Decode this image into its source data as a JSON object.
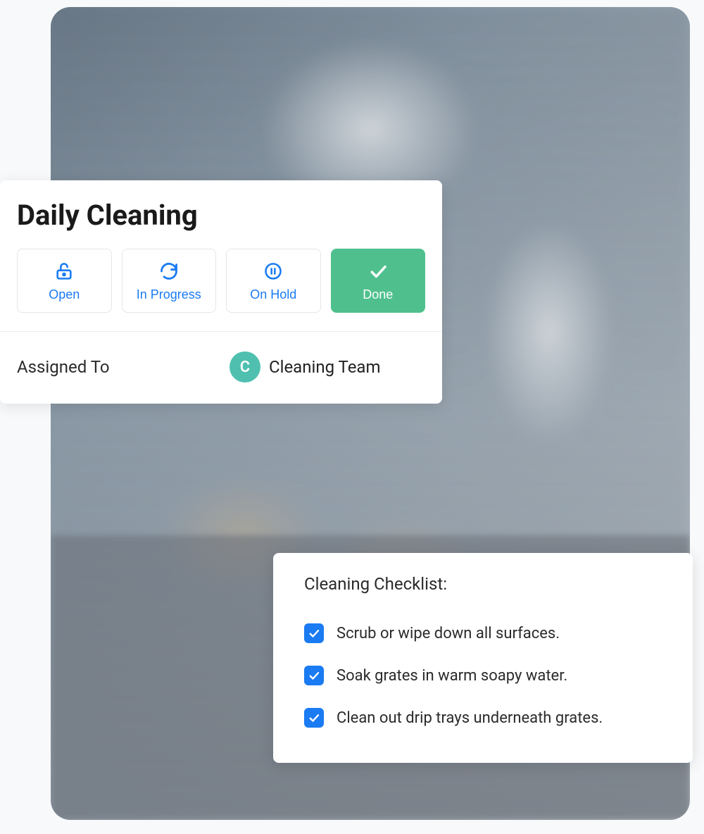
{
  "task": {
    "title": "Daily Cleaning",
    "statuses": [
      {
        "icon": "unlock",
        "label": "Open",
        "active": false
      },
      {
        "icon": "refresh",
        "label": "In Progress",
        "active": false
      },
      {
        "icon": "pause-circle",
        "label": "On Hold",
        "active": false
      },
      {
        "icon": "check",
        "label": "Done",
        "active": true
      }
    ],
    "assigned": {
      "label": "Assigned To",
      "initial": "C",
      "name": "Cleaning Team"
    }
  },
  "checklist": {
    "title": "Cleaning Checklist:",
    "items": [
      {
        "checked": true,
        "label": "Scrub or wipe down all surfaces."
      },
      {
        "checked": true,
        "label": "Soak grates in warm soapy water."
      },
      {
        "checked": true,
        "label": "Clean out drip trays underneath grates."
      }
    ]
  },
  "colors": {
    "primary": "#1a7bf2",
    "success": "#4fc08d",
    "avatar": "#4fc0b0"
  }
}
